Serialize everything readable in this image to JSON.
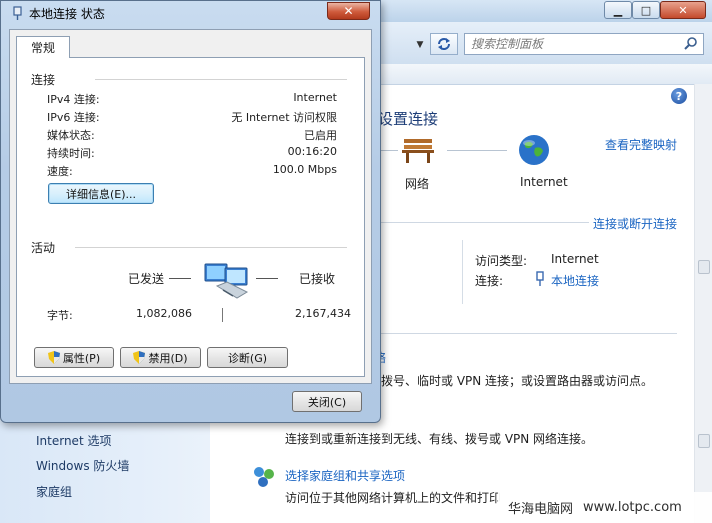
{
  "background": {
    "search": {
      "placeholder": "搜索控制面板"
    },
    "help_label": "?",
    "header": {
      "title": "设置连接",
      "view_full_map": "查看完整映射"
    },
    "network_map": {
      "network_label": "网络",
      "internet_label": "Internet"
    },
    "connect_disconnect": "连接或断开连接",
    "details": {
      "access_type_label": "访问类型:",
      "access_type_value": "Internet",
      "connection_label": "连接:",
      "connection_value": "本地连接"
    },
    "tasks": {
      "task1_title": "络",
      "task1_desc": "拨号、临时或 VPN 连接；或设置路由器或访问点。",
      "task2_desc": "连接到或重新连接到无线、有线、拨号或 VPN 网络连接。",
      "task3_title": "选择家庭组和共享选项",
      "task3_desc": "访问位于其他网络计算机上的文件和打印"
    },
    "left_links": [
      "Internet 选项",
      "Windows 防火墙",
      "家庭组"
    ]
  },
  "dialog": {
    "title": "本地连接 状态",
    "close_glyph": "✕",
    "tab": "常规",
    "connection": {
      "group_title": "连接",
      "rows": [
        {
          "label": "IPv4 连接:",
          "value": "Internet"
        },
        {
          "label": "IPv6 连接:",
          "value": "无 Internet 访问权限"
        },
        {
          "label": "媒体状态:",
          "value": "已启用"
        },
        {
          "label": "持续时间:",
          "value": "00:16:20"
        },
        {
          "label": "速度:",
          "value": "100.0 Mbps"
        }
      ],
      "details_button": "详细信息(E)..."
    },
    "activity": {
      "group_title": "活动",
      "sent_label": "已发送",
      "received_label": "已接收",
      "bytes_label": "字节:",
      "bytes_sent": "1,082,086",
      "bytes_received": "2,167,434"
    },
    "buttons": {
      "properties": "属性(P)",
      "disable": "禁用(D)",
      "diagnose": "诊断(G)",
      "close": "关闭(C)"
    }
  },
  "watermark": {
    "text_cn": "华海电脑网",
    "text_url": "www.lotpc.com"
  }
}
